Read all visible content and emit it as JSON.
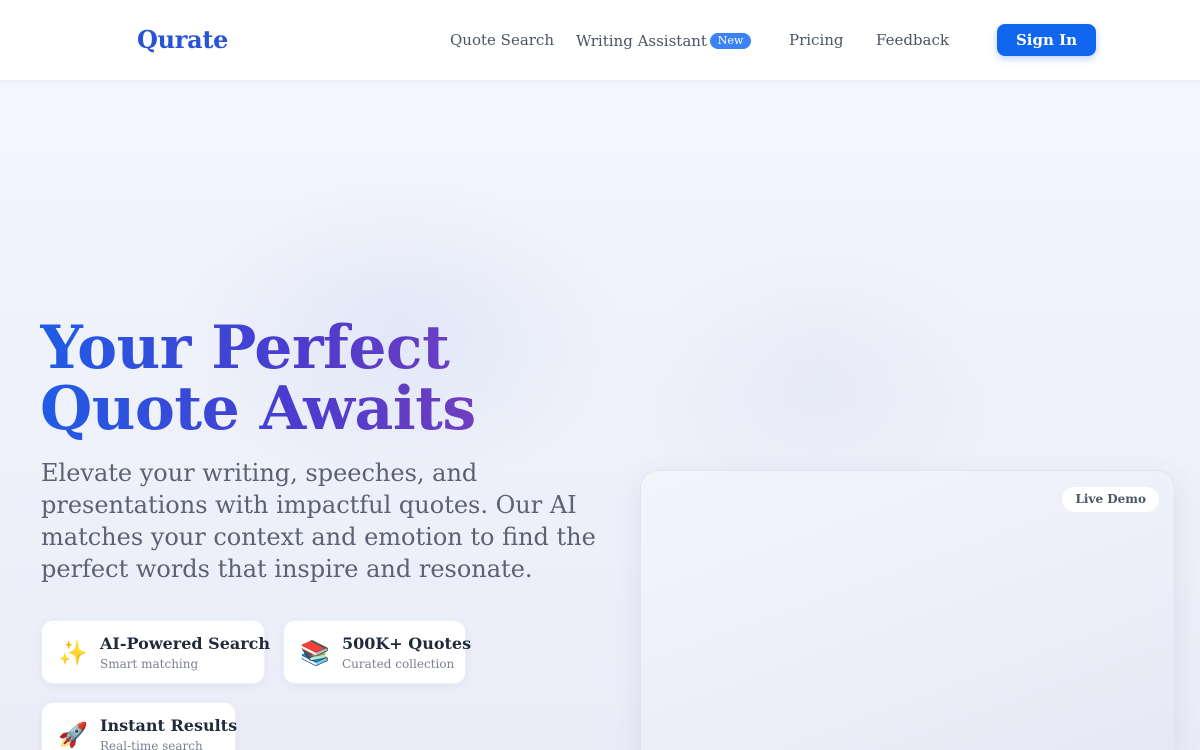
{
  "header": {
    "logo": "Qurate",
    "nav": {
      "quote_search": "Quote Search",
      "writing_assistant": "Writing Assistant",
      "new_badge": "New",
      "pricing": "Pricing",
      "feedback": "Feedback"
    },
    "sign_in": "Sign In"
  },
  "hero": {
    "title_line1": "Your Perfect",
    "title_line2": "Quote Awaits",
    "description": "Elevate your writing, speeches, and presentations with impactful quotes. Our AI matches your context and emotion to find the perfect words that inspire and resonate.",
    "features": [
      {
        "icon": "sparkles-icon",
        "glyph": "✨",
        "title": "AI-Powered Search",
        "subtitle": "Smart matching"
      },
      {
        "icon": "books-icon",
        "glyph": "📚",
        "title": "500K+ Quotes",
        "subtitle": "Curated collection"
      },
      {
        "icon": "rocket-icon",
        "glyph": "🚀",
        "title": "Instant Results",
        "subtitle": "Real-time search"
      }
    ]
  },
  "demo": {
    "badge": "Live Demo"
  },
  "colors": {
    "brand": "#2754d6",
    "primary_button": "#1166f0",
    "badge_blue": "#3b82f6",
    "gradient_start": "#1f5ce6",
    "gradient_end": "#8a3fb7"
  }
}
